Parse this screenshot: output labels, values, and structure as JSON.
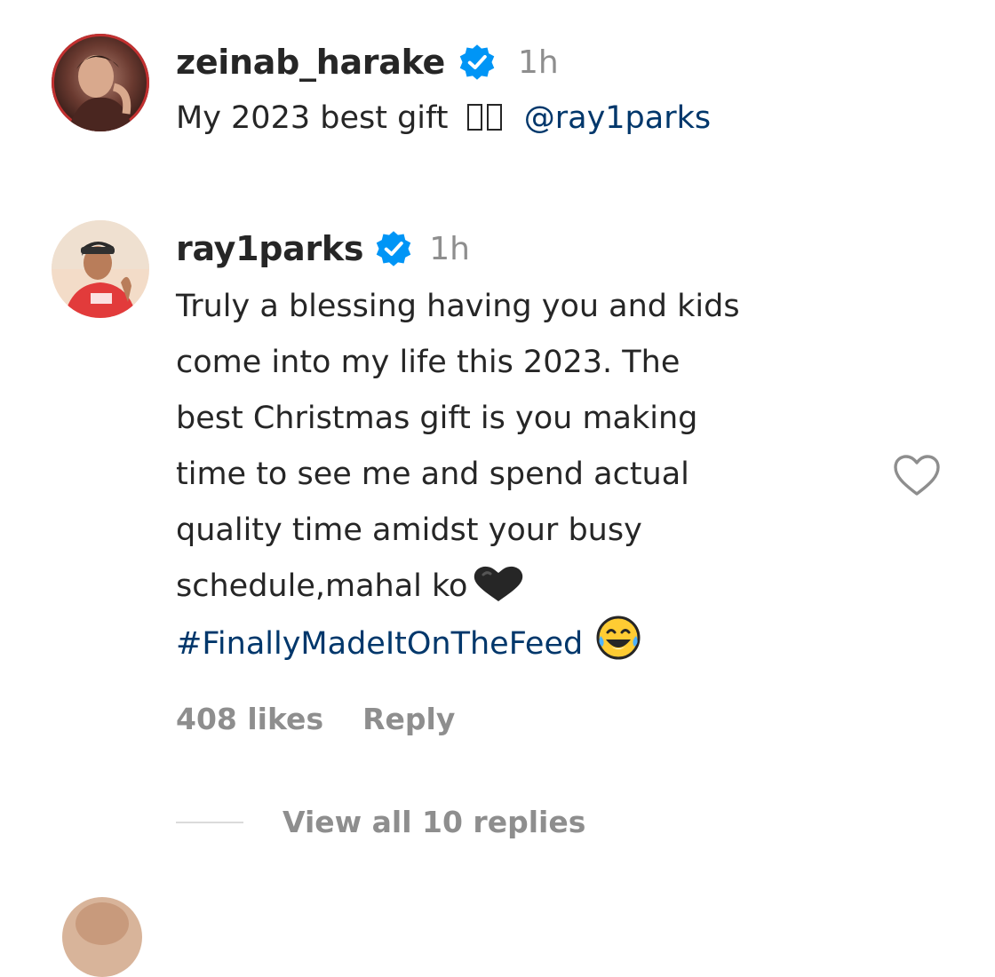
{
  "comments": [
    {
      "username": "zeinab_harake",
      "verified": true,
      "time": "1h",
      "text_before": "My 2023 best gift",
      "mention": "@ray1parks",
      "avatar_icon": "profile-photo"
    },
    {
      "username": "ray1parks",
      "verified": true,
      "time": "1h",
      "lines": [
        "Truly a blessing having you and kids",
        "come into my life this 2023. The",
        "best Christmas gift is you making",
        "time to see me and spend actual",
        "quality time amidst your busy",
        "schedule,mahal ko"
      ],
      "hashtag": "#FinallyMadeItOnTheFeed",
      "emoji_heart": "black-heart-emoji",
      "emoji_laugh": "tears-of-joy-emoji",
      "likes": "408 likes",
      "reply_label": "Reply",
      "view_replies": "View all 10 replies",
      "like_icon": "heart-outline-icon",
      "avatar_icon": "profile-photo"
    }
  ],
  "colors": {
    "text": "#262626",
    "secondary": "#8e8e8e",
    "link": "#00376b",
    "verified": "#0095f6",
    "divider": "#dbdbdb"
  }
}
